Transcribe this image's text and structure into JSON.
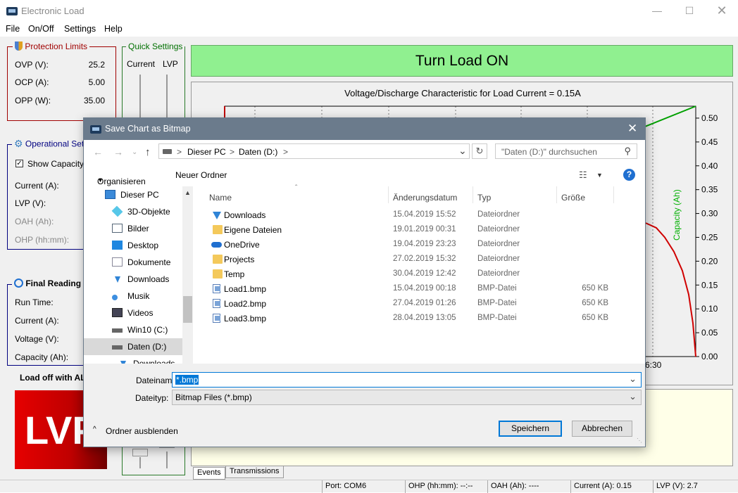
{
  "app": {
    "title": "Electronic Load"
  },
  "menu": [
    "File",
    "On/Off",
    "Settings",
    "Help"
  ],
  "protection": {
    "title": "Protection Limits",
    "rows": [
      {
        "label": "OVP (V):",
        "value": "25.2"
      },
      {
        "label": "OCP (A):",
        "value": "5.00"
      },
      {
        "label": "OPP (W):",
        "value": "35.00"
      }
    ]
  },
  "quick": {
    "title": "Quick Settings",
    "col1": "Current",
    "col2": "LVP"
  },
  "operational": {
    "title": "Operational Set",
    "show_capacity": "Show Capacity C",
    "rows": [
      "Current (A):",
      "LVP (V):",
      "OAH (Ah):",
      "OHP (hh:mm):"
    ]
  },
  "final": {
    "title": "Final Reading",
    "rows": [
      "Run Time:",
      "Current (A):",
      "Voltage (V):",
      "Capacity (Ah):"
    ],
    "alarm_text": "Load off with ALA",
    "alarm_badge": "LVP"
  },
  "turn_on_label": "Turn Load ON",
  "chart_data": {
    "type": "line",
    "title": "Voltage/Discharge Characteristic for Load Current = 0.15A",
    "y2label": "Capacity (Ah)",
    "y2_ticks": [
      "0.50",
      "0.45",
      "0.40",
      "0.35",
      "0.30",
      "0.25",
      "0.20",
      "0.15",
      "0.10",
      "0.05",
      "0.00"
    ],
    "y2lim": [
      0,
      0.525
    ],
    "x_tick_visible": "6:30",
    "series": [
      {
        "color": "#00a000",
        "values": [
          0.48,
          0.525
        ]
      },
      {
        "color": "#d00000",
        "values": [
          0.28,
          0.27,
          0.25,
          0.22,
          0.18,
          0.13,
          0.07,
          0.0
        ]
      }
    ],
    "grid": true
  },
  "tabs": [
    "Events",
    "Transmissions"
  ],
  "status": {
    "port": "Port:  COM6",
    "ohp": "OHP (hh:mm):   --:--",
    "oah": "OAH (Ah):   ----",
    "current": "Current (A):   0.15",
    "lvp": "LVP (V):   2.7"
  },
  "dialog": {
    "title": "Save Chart as Bitmap",
    "breadcrumb": [
      ">",
      "Dieser PC",
      ">",
      "Daten (D:)",
      ">"
    ],
    "search_placeholder": "\"Daten (D:)\" durchsuchen",
    "organize": "Organisieren",
    "new_folder": "Neuer Ordner",
    "tree": [
      {
        "label": "Dieser PC",
        "indent": 0,
        "icon": "pc"
      },
      {
        "label": "3D-Objekte",
        "indent": 1,
        "icon": "cube"
      },
      {
        "label": "Bilder",
        "indent": 1,
        "icon": "pictures"
      },
      {
        "label": "Desktop",
        "indent": 1,
        "icon": "desktop"
      },
      {
        "label": "Dokumente",
        "indent": 1,
        "icon": "docs"
      },
      {
        "label": "Downloads",
        "indent": 1,
        "icon": "download"
      },
      {
        "label": "Musik",
        "indent": 1,
        "icon": "music"
      },
      {
        "label": "Videos",
        "indent": 1,
        "icon": "video"
      },
      {
        "label": "Win10 (C:)",
        "indent": 1,
        "icon": "drive"
      },
      {
        "label": "Daten (D:)",
        "indent": 1,
        "icon": "drive",
        "selected": true
      },
      {
        "label": "Downloads",
        "indent": 2,
        "icon": "download"
      }
    ],
    "columns": [
      "Name",
      "Änderungsdatum",
      "Typ",
      "Größe"
    ],
    "files": [
      {
        "name": "Downloads",
        "date": "15.04.2019 15:52",
        "type": "Dateiordner",
        "size": "",
        "icon": "download"
      },
      {
        "name": "Eigene Dateien",
        "date": "19.01.2019 00:31",
        "type": "Dateiordner",
        "size": "",
        "icon": "folder"
      },
      {
        "name": "OneDrive",
        "date": "19.04.2019 23:23",
        "type": "Dateiordner",
        "size": "",
        "icon": "cloud"
      },
      {
        "name": "Projects",
        "date": "27.02.2019 15:32",
        "type": "Dateiordner",
        "size": "",
        "icon": "folder"
      },
      {
        "name": "Temp",
        "date": "30.04.2019 12:42",
        "type": "Dateiordner",
        "size": "",
        "icon": "folder"
      },
      {
        "name": "Load1.bmp",
        "date": "15.04.2019 00:18",
        "type": "BMP-Datei",
        "size": "650 KB",
        "icon": "bmp"
      },
      {
        "name": "Load2.bmp",
        "date": "27.04.2019 01:26",
        "type": "BMP-Datei",
        "size": "650 KB",
        "icon": "bmp"
      },
      {
        "name": "Load3.bmp",
        "date": "28.04.2019 13:05",
        "type": "BMP-Datei",
        "size": "650 KB",
        "icon": "bmp"
      }
    ],
    "filename_label": "Dateiname:",
    "filename_value": "*.bmp",
    "filetype_label": "Dateityp:",
    "filetype_value": "Bitmap Files (*.bmp)",
    "hide_folders": "Ordner ausblenden",
    "save": "Speichern",
    "cancel": "Abbrechen"
  }
}
